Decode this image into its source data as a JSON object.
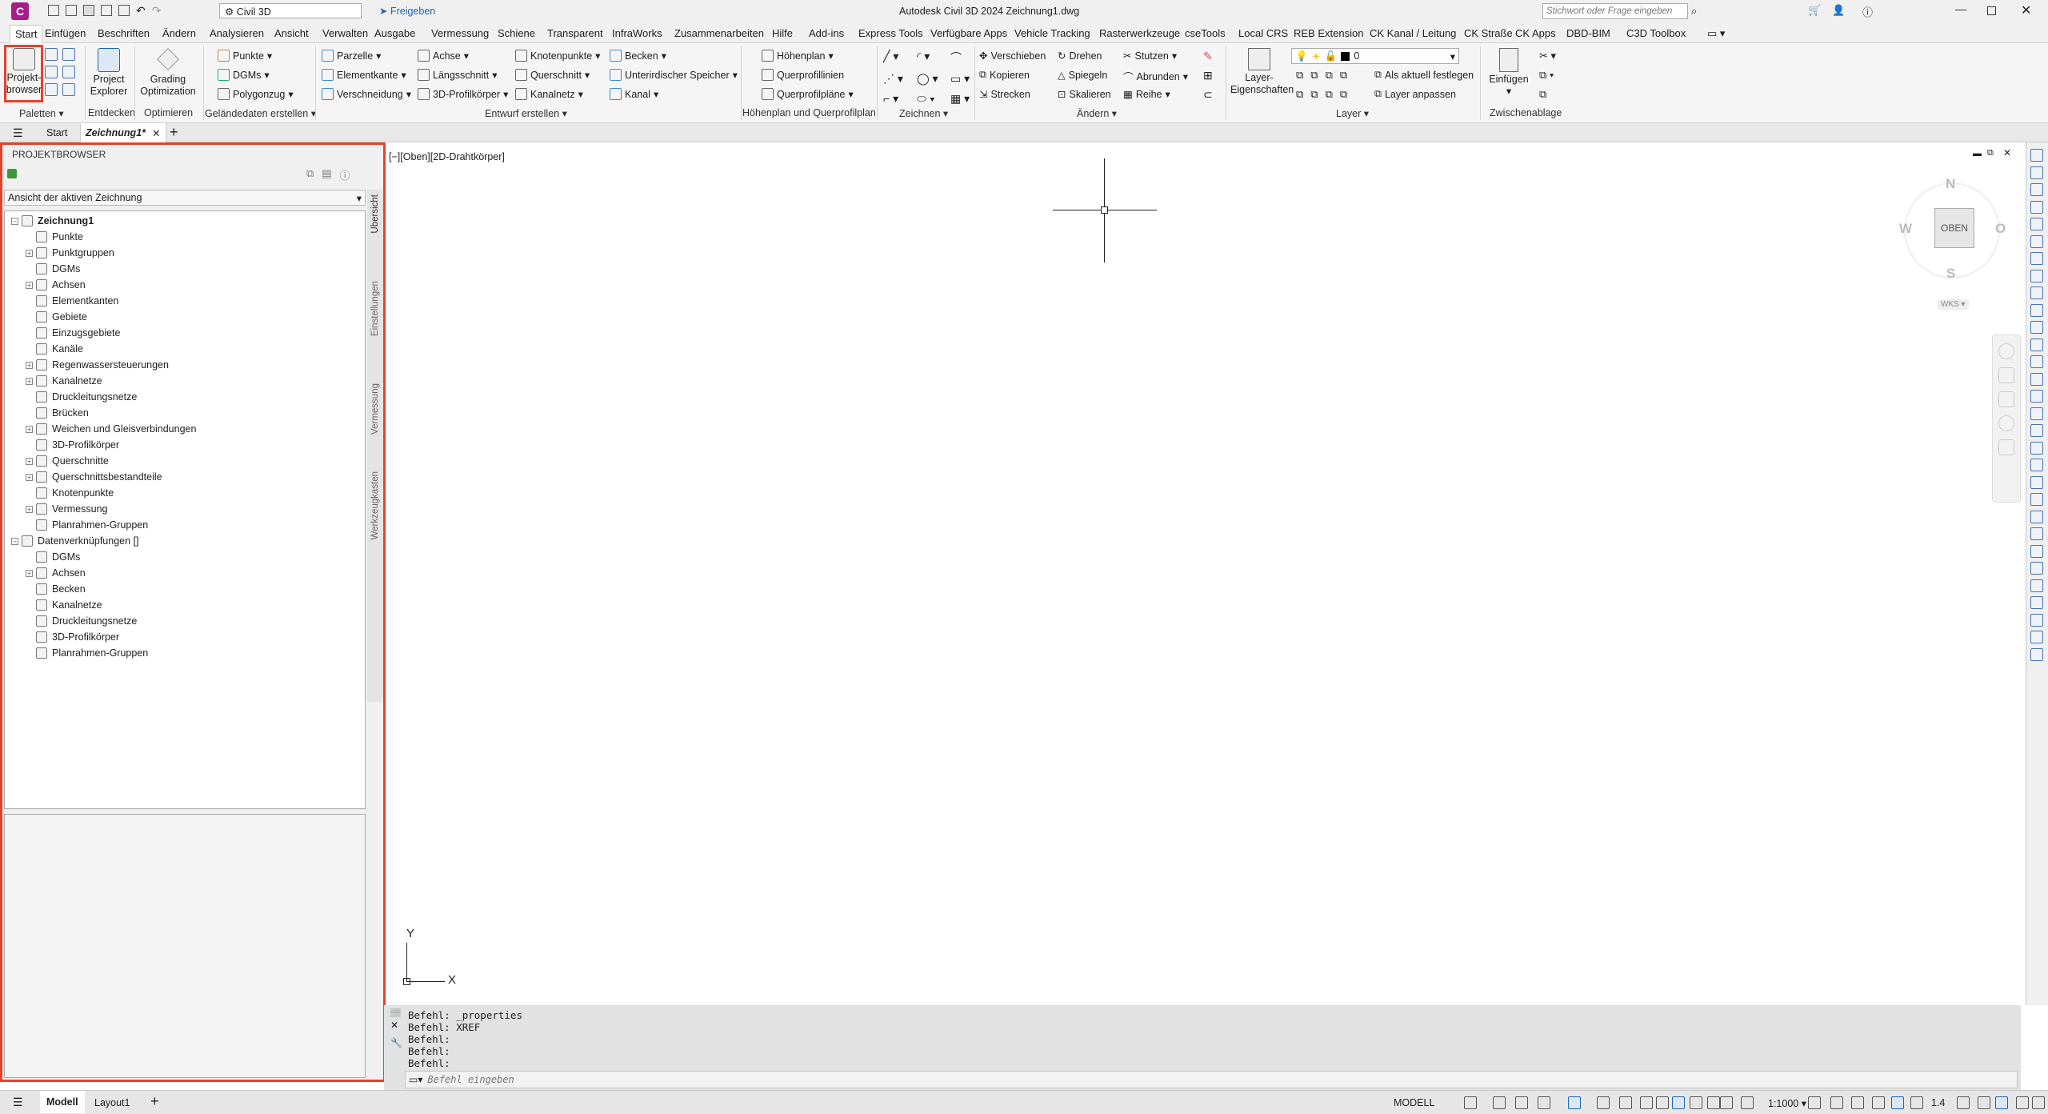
{
  "window": {
    "title": "Autodesk Civil 3D 2024  Zeichnung1.dwg",
    "workspace": "Civil 3D",
    "share_label": "Freigeben",
    "search_placeholder": "Stichwort oder Frage eingeben"
  },
  "ribbon_tabs": [
    "Start",
    "Einfügen",
    "Beschriften",
    "Ändern",
    "Analysieren",
    "Ansicht",
    "Verwalten",
    "Ausgabe",
    "Vermessung",
    "Schiene",
    "Transparent",
    "InfraWorks",
    "Zusammenarbeiten",
    "Hilfe",
    "Add-ins",
    "Express Tools",
    "Verfügbare Apps",
    "Vehicle Tracking",
    "Rasterwerkzeuge",
    "cseTools",
    "Local CRS",
    "REB Extension",
    "CK Kanal / Leitung",
    "CK Straße",
    "CK Apps",
    "DBD-BIM",
    "C3D Toolbox"
  ],
  "ribbon": {
    "paletten": {
      "projektbrowser": "Projekt-\nbrowser",
      "title": "Paletten"
    },
    "entdecken": {
      "project_explorer": "Project\nExplorer",
      "title": "Entdecken"
    },
    "optimieren": {
      "grading": "Grading\nOptimization",
      "title": "Optimieren"
    },
    "gelaende": {
      "punkte": "Punkte",
      "dgms": "DGMs",
      "polygonzug": "Polygonzug",
      "title": "Geländedaten erstellen"
    },
    "entwurf": {
      "parzelle": "Parzelle",
      "elementkante": "Elementkante",
      "verschneidung": "Verschneidung",
      "achse": "Achse",
      "laengsschnitt": "Längsschnitt",
      "profilkoerper": "3D-Profilkörper",
      "knotenpunkte": "Knotenpunkte",
      "querschnitt": "Querschnitt",
      "kanalnetz": "Kanalnetz",
      "becken": "Becken",
      "unterirdisch": "Unterirdischer Speicher",
      "kanal": "Kanal",
      "title": "Entwurf erstellen"
    },
    "hoehenplan": {
      "hoehenplan": "Höhenplan",
      "querprofillinien": "Querprofillinien",
      "querprofilplaene": "Querprofilpläne",
      "title": "Höhenplan und Querprofilplan"
    },
    "zeichnen": {
      "title": "Zeichnen"
    },
    "aendern": {
      "verschieben": "Verschieben",
      "kopieren": "Kopieren",
      "strecken": "Strecken",
      "drehen": "Drehen",
      "spiegeln": "Spiegeln",
      "skalieren": "Skalieren",
      "stutzen": "Stutzen",
      "abrunden": "Abrunden",
      "reihe": "Reihe",
      "title": "Ändern"
    },
    "layer": {
      "eigenschaften": "Layer-\nEigenschaften",
      "current_layer": "0",
      "aktuell": "Als aktuell festlegen",
      "anpassen": "Layer anpassen",
      "title": "Layer"
    },
    "zwischenablage": {
      "einfuegen": "Einfügen",
      "title": "Zwischenablage"
    }
  },
  "doc_tabs": {
    "start": "Start",
    "drawing": "Zeichnung1*"
  },
  "projektbrowser": {
    "title": "PROJEKTBROWSER",
    "view_select": "Ansicht der aktiven Zeichnung",
    "root": "Zeichnung1",
    "items": [
      {
        "label": "Punkte",
        "expand": false
      },
      {
        "label": "Punktgruppen",
        "expand": true
      },
      {
        "label": "DGMs",
        "expand": false
      },
      {
        "label": "Achsen",
        "expand": true
      },
      {
        "label": "Elementkanten",
        "expand": false
      },
      {
        "label": "Gebiete",
        "expand": false
      },
      {
        "label": "Einzugsgebiete",
        "expand": false
      },
      {
        "label": "Kanäle",
        "expand": false
      },
      {
        "label": "Regenwassersteuerungen",
        "expand": true
      },
      {
        "label": "Kanalnetze",
        "expand": true
      },
      {
        "label": "Druckleitungsnetze",
        "expand": false
      },
      {
        "label": "Brücken",
        "expand": false
      },
      {
        "label": "Weichen und Gleisverbindungen",
        "expand": true
      },
      {
        "label": "3D-Profilkörper",
        "expand": false
      },
      {
        "label": "Querschnitte",
        "expand": true
      },
      {
        "label": "Querschnittsbestandteile",
        "expand": true
      },
      {
        "label": "Knotenpunkte",
        "expand": false
      },
      {
        "label": "Vermessung",
        "expand": true
      },
      {
        "label": "Planrahmen-Gruppen",
        "expand": false
      }
    ],
    "links_root": "Datenverknüpfungen []",
    "link_items": [
      {
        "label": "DGMs",
        "expand": false
      },
      {
        "label": "Achsen",
        "expand": true
      },
      {
        "label": "Becken",
        "expand": false
      },
      {
        "label": "Kanalnetze",
        "expand": false
      },
      {
        "label": "Druckleitungsnetze",
        "expand": false
      },
      {
        "label": "3D-Profilkörper",
        "expand": false
      },
      {
        "label": "Planrahmen-Gruppen",
        "expand": false
      }
    ],
    "side_tabs": [
      "Übersicht",
      "Einstellungen",
      "Vermessung",
      "Werkzeugkasten"
    ]
  },
  "viewport": {
    "label": "[−][Oben][2D-Drahtkörper]",
    "viewcube": {
      "n": "N",
      "s": "S",
      "w": "W",
      "o": "O",
      "face": "OBEN",
      "wcs": "WKS"
    }
  },
  "ucs": {
    "x": "X",
    "y": "Y"
  },
  "command": {
    "history": [
      "Befehl: _properties",
      "Befehl: XREF",
      "Befehl:",
      "Befehl:",
      "Befehl:"
    ],
    "placeholder": "Befehl eingeben"
  },
  "status": {
    "model_tab": "Modell",
    "layout_tab": "Layout1",
    "model": "MODELL",
    "scale": "1:1000",
    "annoscale": "1.4"
  },
  "colors": {
    "highlight": "#e8412b",
    "accent": "#1e64b4"
  }
}
